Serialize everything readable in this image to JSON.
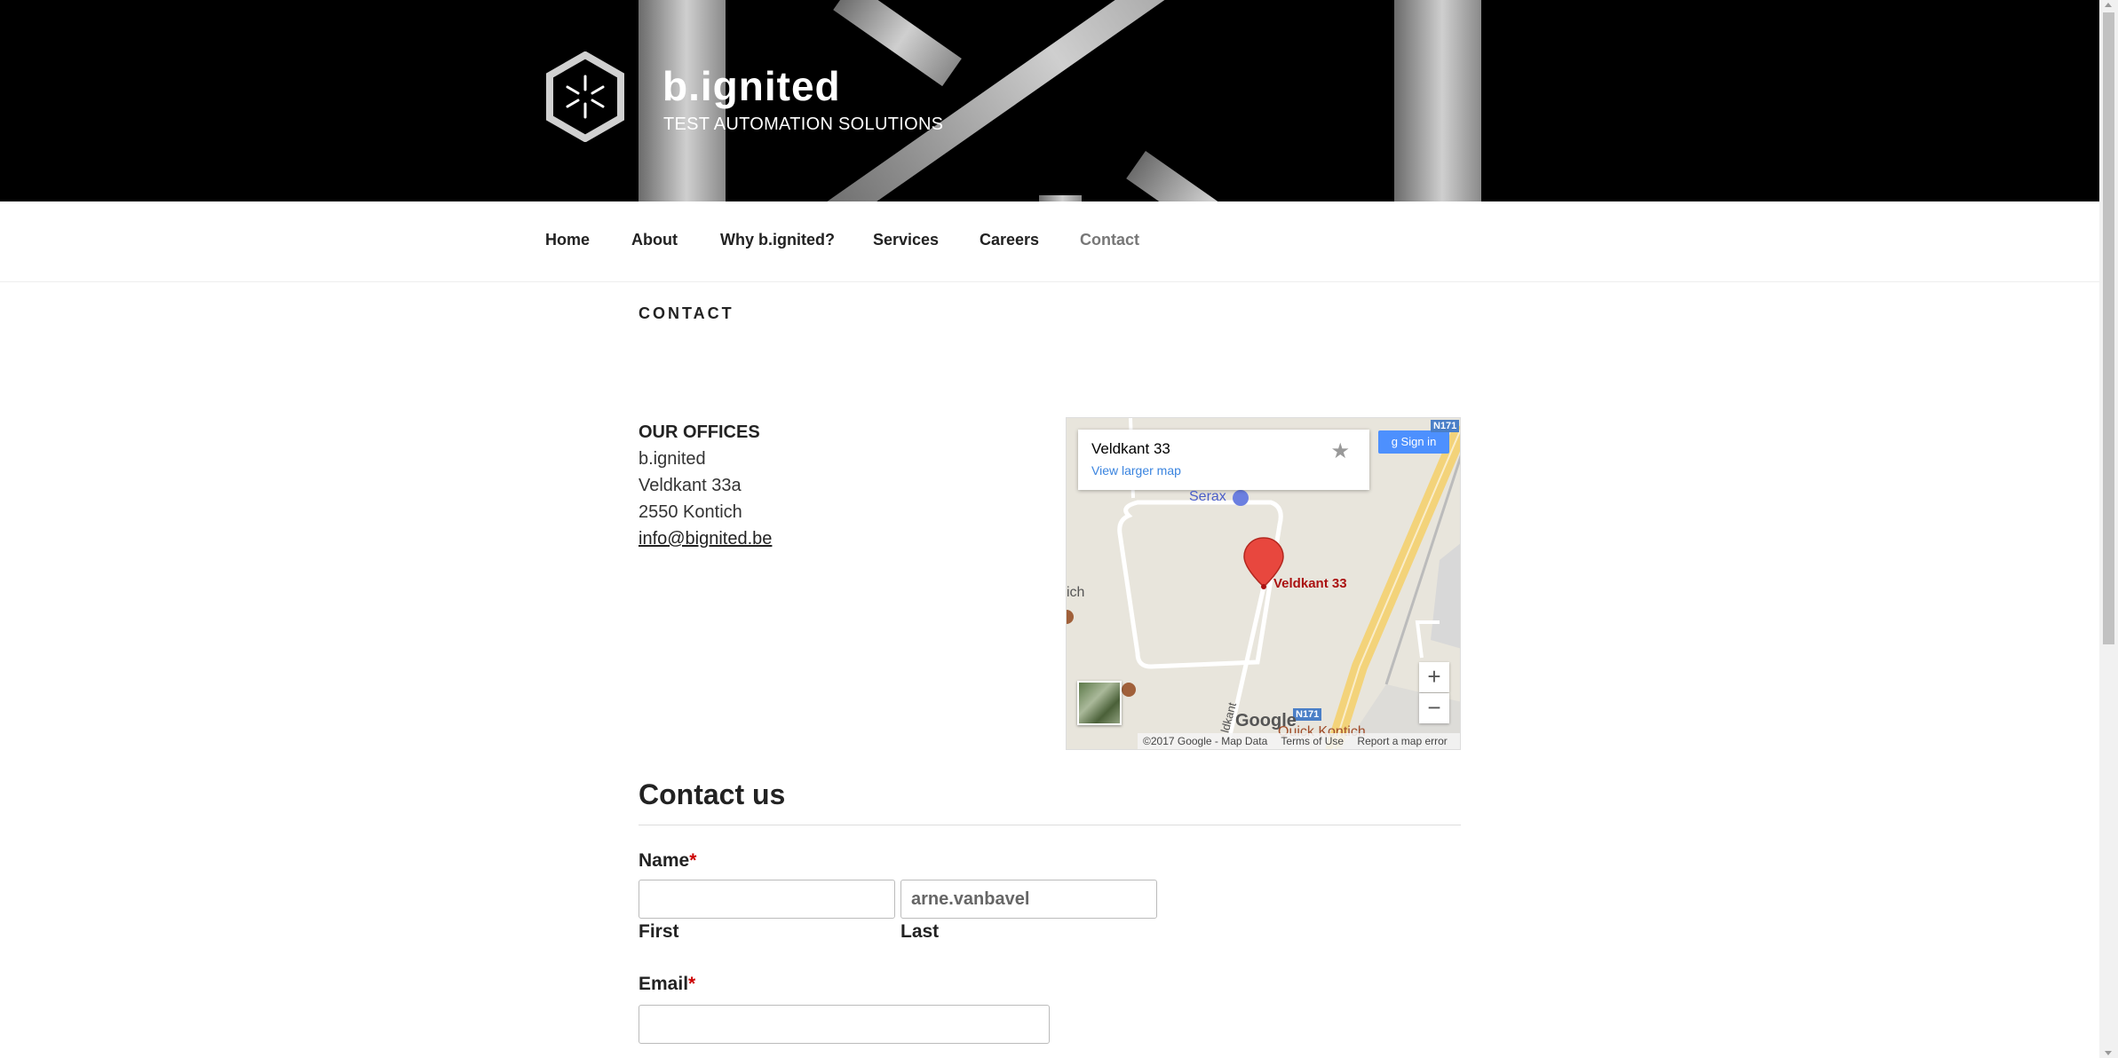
{
  "site": {
    "title": "b.ignited",
    "tagline": "TEST AUTOMATION SOLUTIONS"
  },
  "nav": {
    "items": [
      {
        "label": "Home"
      },
      {
        "label": "About"
      },
      {
        "label": "Why b.ignited?"
      },
      {
        "label": "Services"
      },
      {
        "label": "Careers"
      },
      {
        "label": "Contact",
        "current": true
      }
    ]
  },
  "page": {
    "title": "CONTACT"
  },
  "offices": {
    "heading": "OUR OFFICES",
    "company": "b.ignited",
    "street": "Veldkant 33a",
    "city": "2550 Kontich",
    "email": "info@bignited.be"
  },
  "map": {
    "place_name": "Veldkant 33",
    "larger_map_link": "View larger map",
    "sign_in": "Sign in",
    "pin_label": "Veldkant 33",
    "poi_label": "Serax",
    "road_label": "N171",
    "partial_label_left": "ich",
    "partial_label_bottom": "Quick Kontich",
    "street_label": "ldkant",
    "google_logo": "Google",
    "copyright": "©2017 Google - Map Data",
    "terms": "Terms of Use",
    "report": "Report a map error",
    "zoom_in": "+",
    "zoom_out": "−"
  },
  "form": {
    "heading": "Contact us",
    "name_label": "Name",
    "required_marker": "*",
    "first_label": "First",
    "last_label": "Last",
    "first_value": "",
    "last_value": "arne.vanbavel",
    "email_label": "Email",
    "email_value": ""
  },
  "colors": {
    "header_bg": "#000000",
    "link_blue": "#3a84df",
    "required_red": "#cc0000",
    "nav_current": "#777777"
  }
}
